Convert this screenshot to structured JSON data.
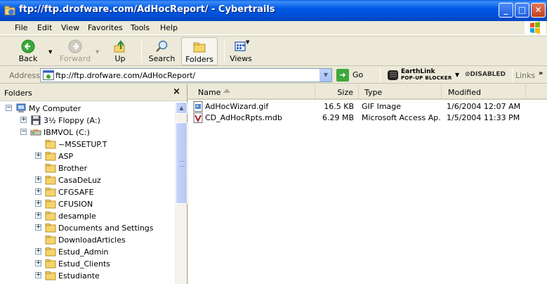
{
  "window": {
    "title": "ftp://ftp.drofware.com/AdHocReport/ - Cybertrails",
    "icon": "ie-folder-icon",
    "controls": [
      "minimize",
      "maximize",
      "close"
    ]
  },
  "menu": [
    "File",
    "Edit",
    "View",
    "Favorites",
    "Tools",
    "Help"
  ],
  "toolbar": {
    "back": "Back",
    "forward": "Forward",
    "up": "Up",
    "search": "Search",
    "folders": "Folders",
    "views": "Views"
  },
  "address": {
    "label": "Address",
    "value": "ftp://ftp.drofware.com/AdHocReport/",
    "go": "Go"
  },
  "earthlink": {
    "brand": "EarthLink",
    "product": "POP-UP BLOCKER",
    "status": "DISABLED"
  },
  "links_label": "Links",
  "folders_pane": {
    "title": "Folders",
    "close": "×",
    "tree": [
      {
        "label": "My Computer",
        "toggle": "−",
        "icon": "computer-icon"
      },
      {
        "label": "3½ Floppy (A:)",
        "toggle": "+",
        "icon": "floppy-icon"
      },
      {
        "label": "IBMVOL (C:)",
        "toggle": "−",
        "icon": "drive-icon"
      },
      {
        "label": "~MSSETUP.T",
        "toggle": "",
        "icon": "folder-icon"
      },
      {
        "label": "ASP",
        "toggle": "+",
        "icon": "folder-icon"
      },
      {
        "label": "Brother",
        "toggle": "",
        "icon": "folder-icon"
      },
      {
        "label": "CasaDeLuz",
        "toggle": "+",
        "icon": "folder-icon"
      },
      {
        "label": "CFGSAFE",
        "toggle": "+",
        "icon": "folder-icon"
      },
      {
        "label": "CFUSION",
        "toggle": "+",
        "icon": "folder-icon"
      },
      {
        "label": "desample",
        "toggle": "+",
        "icon": "folder-icon"
      },
      {
        "label": "Documents and Settings",
        "toggle": "+",
        "icon": "folder-icon"
      },
      {
        "label": "DownloadArticles",
        "toggle": "",
        "icon": "folder-icon"
      },
      {
        "label": "Estud_Admin",
        "toggle": "+",
        "icon": "folder-icon"
      },
      {
        "label": "Estud_Clients",
        "toggle": "+",
        "icon": "folder-icon"
      },
      {
        "label": "Estudiante",
        "toggle": "+",
        "icon": "folder-icon"
      }
    ]
  },
  "file_list": {
    "columns": [
      "Name",
      "Size",
      "Type",
      "Modified"
    ],
    "rows": [
      {
        "name": "AdHocWizard.gif",
        "size": "16.5 KB",
        "type": "GIF Image",
        "modified": "1/6/2004 12:07 AM",
        "icon": "gif-file-icon"
      },
      {
        "name": "CD_AdHocRpts.mdb",
        "size": "6.29 MB",
        "type": "Microsoft Access Ap...",
        "modified": "1/5/2004 11:33 PM",
        "icon": "access-file-icon"
      }
    ]
  }
}
